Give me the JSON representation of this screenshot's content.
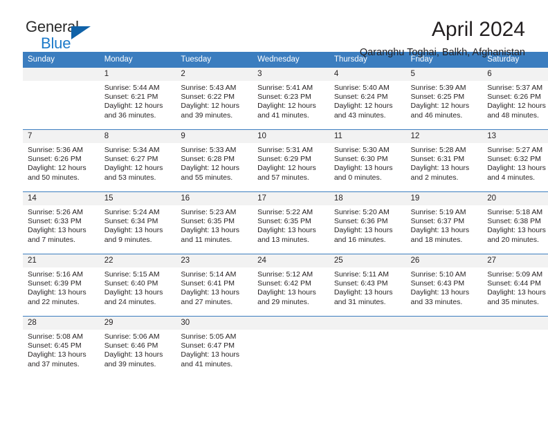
{
  "brand": {
    "name_top": "General",
    "name_bottom": "Blue",
    "triangle_color": "#1062a8",
    "blue_color": "#1c7ac9"
  },
  "header": {
    "title": "April 2024",
    "subtitle": "Qaranghu Toghai, Balkh, Afghanistan"
  },
  "theme": {
    "header_bg": "#3b7dbf",
    "daynum_bg": "#f2f2f2",
    "text": "#231f20"
  },
  "labels": {
    "sunrise_prefix": "Sunrise:",
    "sunset_prefix": "Sunset:",
    "daylight_prefix": "Daylight:"
  },
  "weekday_headers": [
    "Sunday",
    "Monday",
    "Tuesday",
    "Wednesday",
    "Thursday",
    "Friday",
    "Saturday"
  ],
  "weeks": [
    {
      "days": [
        {
          "day": "",
          "empty": true,
          "line1": "",
          "line2": "",
          "line3": "",
          "line4": ""
        },
        {
          "day": "1",
          "empty": false,
          "line1": "Sunrise: 5:44 AM",
          "line2": "Sunset: 6:21 PM",
          "line3": "Daylight: 12 hours",
          "line4": "and 36 minutes."
        },
        {
          "day": "2",
          "empty": false,
          "line1": "Sunrise: 5:43 AM",
          "line2": "Sunset: 6:22 PM",
          "line3": "Daylight: 12 hours",
          "line4": "and 39 minutes."
        },
        {
          "day": "3",
          "empty": false,
          "line1": "Sunrise: 5:41 AM",
          "line2": "Sunset: 6:23 PM",
          "line3": "Daylight: 12 hours",
          "line4": "and 41 minutes."
        },
        {
          "day": "4",
          "empty": false,
          "line1": "Sunrise: 5:40 AM",
          "line2": "Sunset: 6:24 PM",
          "line3": "Daylight: 12 hours",
          "line4": "and 43 minutes."
        },
        {
          "day": "5",
          "empty": false,
          "line1": "Sunrise: 5:39 AM",
          "line2": "Sunset: 6:25 PM",
          "line3": "Daylight: 12 hours",
          "line4": "and 46 minutes."
        },
        {
          "day": "6",
          "empty": false,
          "line1": "Sunrise: 5:37 AM",
          "line2": "Sunset: 6:26 PM",
          "line3": "Daylight: 12 hours",
          "line4": "and 48 minutes."
        }
      ]
    },
    {
      "days": [
        {
          "day": "7",
          "empty": false,
          "line1": "Sunrise: 5:36 AM",
          "line2": "Sunset: 6:26 PM",
          "line3": "Daylight: 12 hours",
          "line4": "and 50 minutes."
        },
        {
          "day": "8",
          "empty": false,
          "line1": "Sunrise: 5:34 AM",
          "line2": "Sunset: 6:27 PM",
          "line3": "Daylight: 12 hours",
          "line4": "and 53 minutes."
        },
        {
          "day": "9",
          "empty": false,
          "line1": "Sunrise: 5:33 AM",
          "line2": "Sunset: 6:28 PM",
          "line3": "Daylight: 12 hours",
          "line4": "and 55 minutes."
        },
        {
          "day": "10",
          "empty": false,
          "line1": "Sunrise: 5:31 AM",
          "line2": "Sunset: 6:29 PM",
          "line3": "Daylight: 12 hours",
          "line4": "and 57 minutes."
        },
        {
          "day": "11",
          "empty": false,
          "line1": "Sunrise: 5:30 AM",
          "line2": "Sunset: 6:30 PM",
          "line3": "Daylight: 13 hours",
          "line4": "and 0 minutes."
        },
        {
          "day": "12",
          "empty": false,
          "line1": "Sunrise: 5:28 AM",
          "line2": "Sunset: 6:31 PM",
          "line3": "Daylight: 13 hours",
          "line4": "and 2 minutes."
        },
        {
          "day": "13",
          "empty": false,
          "line1": "Sunrise: 5:27 AM",
          "line2": "Sunset: 6:32 PM",
          "line3": "Daylight: 13 hours",
          "line4": "and 4 minutes."
        }
      ]
    },
    {
      "days": [
        {
          "day": "14",
          "empty": false,
          "line1": "Sunrise: 5:26 AM",
          "line2": "Sunset: 6:33 PM",
          "line3": "Daylight: 13 hours",
          "line4": "and 7 minutes."
        },
        {
          "day": "15",
          "empty": false,
          "line1": "Sunrise: 5:24 AM",
          "line2": "Sunset: 6:34 PM",
          "line3": "Daylight: 13 hours",
          "line4": "and 9 minutes."
        },
        {
          "day": "16",
          "empty": false,
          "line1": "Sunrise: 5:23 AM",
          "line2": "Sunset: 6:35 PM",
          "line3": "Daylight: 13 hours",
          "line4": "and 11 minutes."
        },
        {
          "day": "17",
          "empty": false,
          "line1": "Sunrise: 5:22 AM",
          "line2": "Sunset: 6:35 PM",
          "line3": "Daylight: 13 hours",
          "line4": "and 13 minutes."
        },
        {
          "day": "18",
          "empty": false,
          "line1": "Sunrise: 5:20 AM",
          "line2": "Sunset: 6:36 PM",
          "line3": "Daylight: 13 hours",
          "line4": "and 16 minutes."
        },
        {
          "day": "19",
          "empty": false,
          "line1": "Sunrise: 5:19 AM",
          "line2": "Sunset: 6:37 PM",
          "line3": "Daylight: 13 hours",
          "line4": "and 18 minutes."
        },
        {
          "day": "20",
          "empty": false,
          "line1": "Sunrise: 5:18 AM",
          "line2": "Sunset: 6:38 PM",
          "line3": "Daylight: 13 hours",
          "line4": "and 20 minutes."
        }
      ]
    },
    {
      "days": [
        {
          "day": "21",
          "empty": false,
          "line1": "Sunrise: 5:16 AM",
          "line2": "Sunset: 6:39 PM",
          "line3": "Daylight: 13 hours",
          "line4": "and 22 minutes."
        },
        {
          "day": "22",
          "empty": false,
          "line1": "Sunrise: 5:15 AM",
          "line2": "Sunset: 6:40 PM",
          "line3": "Daylight: 13 hours",
          "line4": "and 24 minutes."
        },
        {
          "day": "23",
          "empty": false,
          "line1": "Sunrise: 5:14 AM",
          "line2": "Sunset: 6:41 PM",
          "line3": "Daylight: 13 hours",
          "line4": "and 27 minutes."
        },
        {
          "day": "24",
          "empty": false,
          "line1": "Sunrise: 5:12 AM",
          "line2": "Sunset: 6:42 PM",
          "line3": "Daylight: 13 hours",
          "line4": "and 29 minutes."
        },
        {
          "day": "25",
          "empty": false,
          "line1": "Sunrise: 5:11 AM",
          "line2": "Sunset: 6:43 PM",
          "line3": "Daylight: 13 hours",
          "line4": "and 31 minutes."
        },
        {
          "day": "26",
          "empty": false,
          "line1": "Sunrise: 5:10 AM",
          "line2": "Sunset: 6:43 PM",
          "line3": "Daylight: 13 hours",
          "line4": "and 33 minutes."
        },
        {
          "day": "27",
          "empty": false,
          "line1": "Sunrise: 5:09 AM",
          "line2": "Sunset: 6:44 PM",
          "line3": "Daylight: 13 hours",
          "line4": "and 35 minutes."
        }
      ]
    },
    {
      "days": [
        {
          "day": "28",
          "empty": false,
          "line1": "Sunrise: 5:08 AM",
          "line2": "Sunset: 6:45 PM",
          "line3": "Daylight: 13 hours",
          "line4": "and 37 minutes."
        },
        {
          "day": "29",
          "empty": false,
          "line1": "Sunrise: 5:06 AM",
          "line2": "Sunset: 6:46 PM",
          "line3": "Daylight: 13 hours",
          "line4": "and 39 minutes."
        },
        {
          "day": "30",
          "empty": false,
          "line1": "Sunrise: 5:05 AM",
          "line2": "Sunset: 6:47 PM",
          "line3": "Daylight: 13 hours",
          "line4": "and 41 minutes."
        },
        {
          "day": "",
          "empty": true,
          "line1": "",
          "line2": "",
          "line3": "",
          "line4": ""
        },
        {
          "day": "",
          "empty": true,
          "line1": "",
          "line2": "",
          "line3": "",
          "line4": ""
        },
        {
          "day": "",
          "empty": true,
          "line1": "",
          "line2": "",
          "line3": "",
          "line4": ""
        },
        {
          "day": "",
          "empty": true,
          "line1": "",
          "line2": "",
          "line3": "",
          "line4": ""
        }
      ]
    }
  ]
}
